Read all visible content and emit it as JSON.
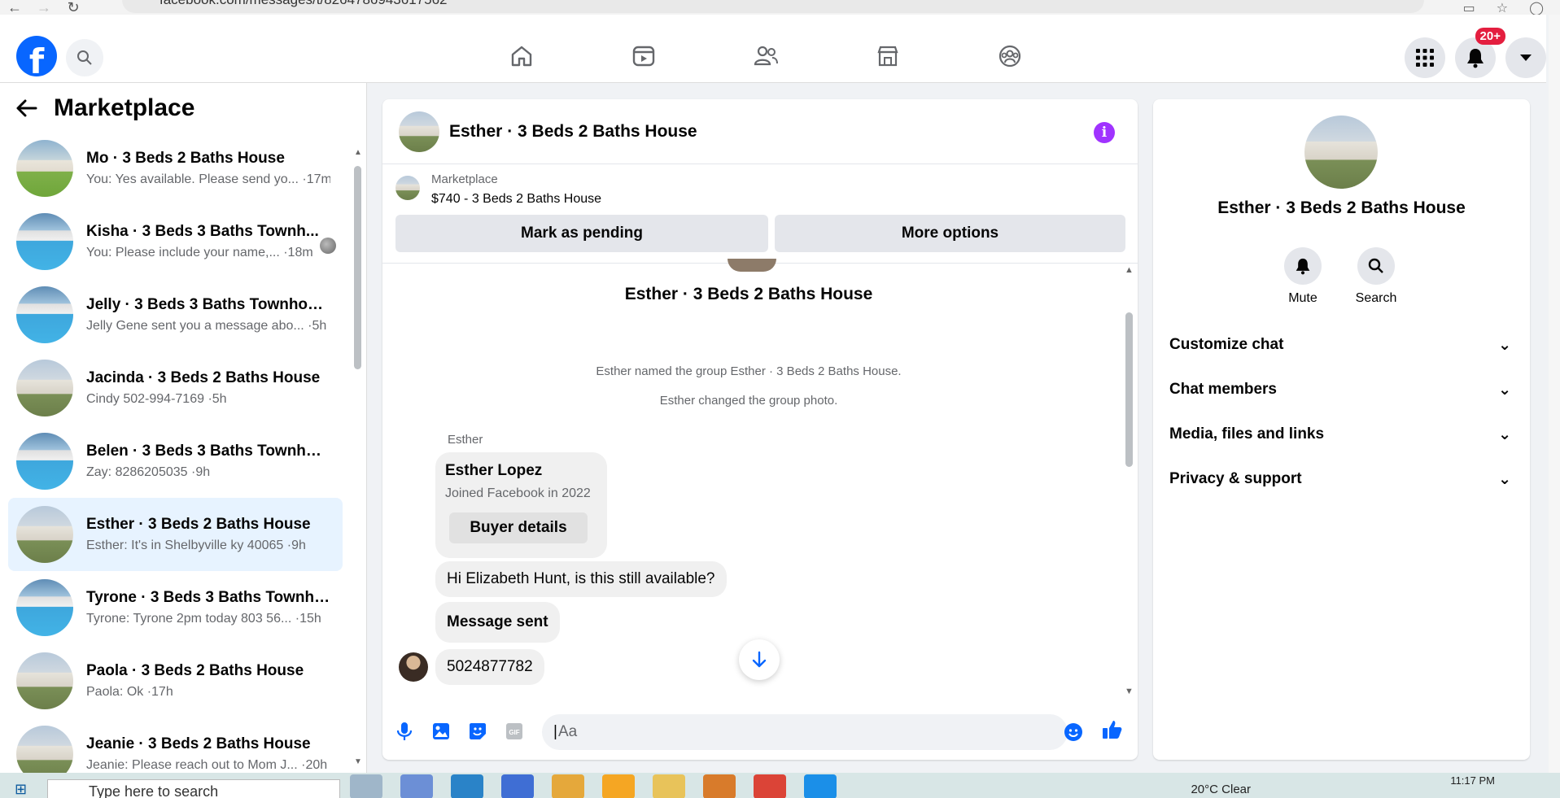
{
  "browser": {
    "url": "facebook.com/messages/t/8264786943617562"
  },
  "header": {
    "notification_badge": "20+"
  },
  "sidebar": {
    "title": "Marketplace",
    "conversations": [
      {
        "name": "Mo · 3 Beds 2 Baths House",
        "preview": "You: Yes available. Please send yo... ·17m",
        "thumb": "green"
      },
      {
        "name": "Kisha · 3 Beds 3 Baths Townh...",
        "preview": "You: Please include your name,... ·18m",
        "thumb": "pool"
      },
      {
        "name": "Jelly · 3 Beds 3 Baths Townhouse",
        "preview": "Jelly Gene sent you a message abo... ·5h",
        "thumb": "pool"
      },
      {
        "name": "Jacinda · 3 Beds 2 Baths House",
        "preview": "Cindy 502-994-7169 ·5h",
        "thumb": "house"
      },
      {
        "name": "Belen · 3 Beds 3 Baths Townhouse",
        "preview": "Zay: 8286205035 ·9h",
        "thumb": "pool"
      },
      {
        "name": "Esther · 3 Beds 2 Baths House",
        "preview": "Esther: It's in Shelbyville ky 40065 ·9h",
        "thumb": "house"
      },
      {
        "name": "Tyrone · 3 Beds 3 Baths Townho...",
        "preview": "Tyrone: Tyrone 2pm today 803 56... ·15h",
        "thumb": "pool"
      },
      {
        "name": "Paola · 3 Beds 2 Baths House",
        "preview": "Paola: Ok ·17h",
        "thumb": "house"
      },
      {
        "name": "Jeanie · 3 Beds 2 Baths House",
        "preview": "Jeanie: Please reach out to Mom J... ·20h",
        "thumb": "house"
      }
    ]
  },
  "chat": {
    "title": "Esther · 3 Beds 2 Baths House",
    "marketplace_label": "Marketplace",
    "listing": "$740 - 3 Beds 2 Baths House",
    "mark_pending": "Mark as pending",
    "more_options": "More options",
    "group_name": "Esther · 3 Beds 2 Baths House",
    "system_messages": [
      "Esther named the group Esther · 3 Beds 2 Baths House.",
      "Esther changed the group photo."
    ],
    "sender": "Esther",
    "buyer_card": {
      "name": "Esther Lopez",
      "joined": "Joined Facebook in 2022",
      "button": "Buyer details"
    },
    "messages": [
      "Hi Elizabeth Hunt, is this still available?",
      "Message sent",
      "5024877782"
    ],
    "input_placeholder": "Aa"
  },
  "info_panel": {
    "name": "Esther · 3 Beds 2 Baths House",
    "actions": [
      "Mute",
      "Search"
    ],
    "sections": [
      "Customize chat",
      "Chat members",
      "Media, files and links",
      "Privacy & support"
    ]
  },
  "taskbar": {
    "search_placeholder": "Type here to search",
    "weather": "20°C Clear",
    "time": "11:17 PM"
  },
  "colors": {
    "brand": "#0866ff",
    "active_conv": "#e7f3ff",
    "info_accent": "#a033ff"
  }
}
